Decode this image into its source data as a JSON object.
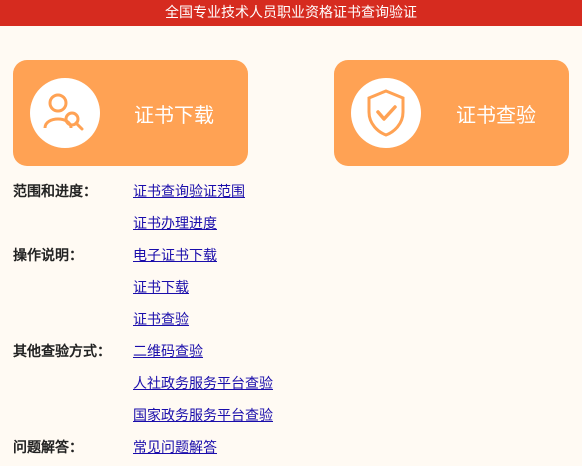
{
  "header": {
    "title": "全国专业技术人员职业资格证书查询验证"
  },
  "cards": [
    {
      "label": "证书下载",
      "icon": "user-search-icon"
    },
    {
      "label": "证书查验",
      "icon": "shield-check-icon"
    }
  ],
  "sections": {
    "scope": {
      "key": "范围和进度：",
      "links": [
        "证书查询验证范围",
        "证书办理进度"
      ]
    },
    "ops": {
      "key": "操作说明：",
      "links": [
        "电子证书下载",
        "证书下载",
        "证书查验"
      ]
    },
    "other": {
      "key": "其他查验方式：",
      "links": [
        "二维码查验",
        "人社政务服务平台查验",
        "国家政务服务平台查验"
      ]
    },
    "faq": {
      "key": "问题解答：",
      "links": [
        "常见问题解答"
      ]
    }
  },
  "colors": {
    "header": "#d62b1f",
    "card": "#ffa254",
    "link": "#1a0dab"
  }
}
